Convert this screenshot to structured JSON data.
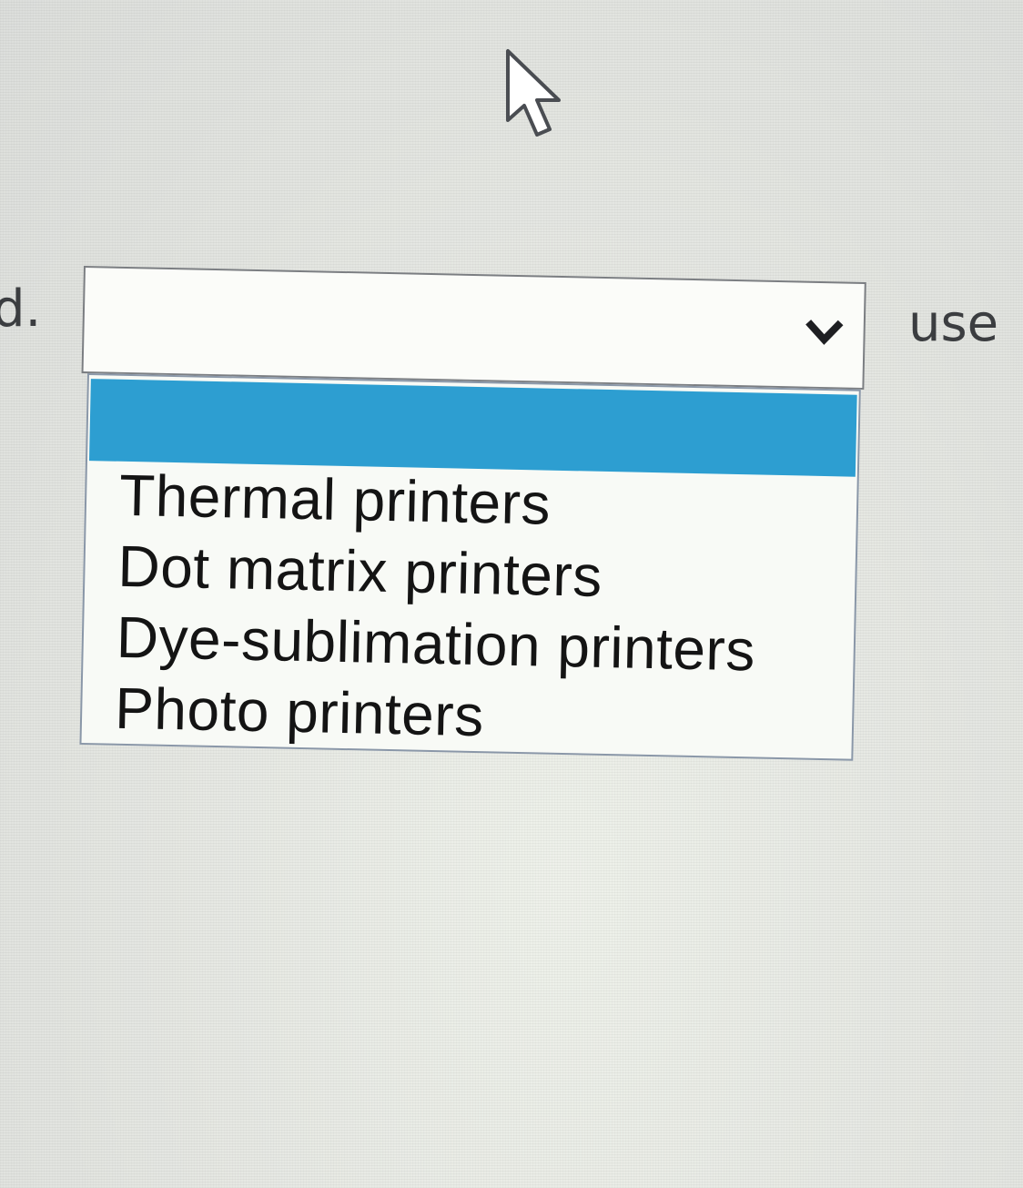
{
  "left_fragment": "d.",
  "right_fragment": "use",
  "select": {
    "value": ""
  },
  "dropdown": {
    "options": [
      {
        "label": "",
        "highlighted": true
      },
      {
        "label": "Thermal printers",
        "highlighted": false
      },
      {
        "label": "Dot matrix printers",
        "highlighted": false
      },
      {
        "label": "Dye-sublimation printers",
        "highlighted": false
      },
      {
        "label": "Photo printers",
        "highlighted": false
      }
    ],
    "highlight_color": "#2d9ed1"
  },
  "icons": {
    "cursor": "arrow-cursor-icon",
    "chevron": "chevron-down-icon"
  }
}
